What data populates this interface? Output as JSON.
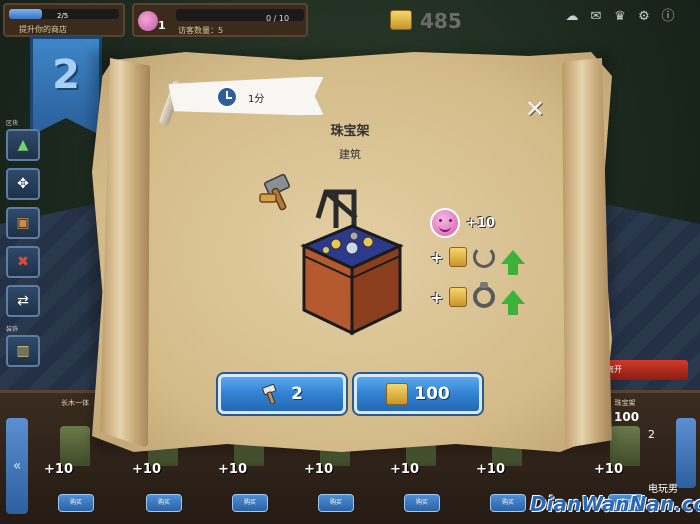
{
  "hud": {
    "xp_value": "2/5",
    "xp_fraction": 0.3,
    "xp_label": "提升你的商店",
    "population_count": "1",
    "population_value": "0 / 10",
    "population_fraction": 0.0,
    "population_label": "访客数量：5",
    "gold": "485",
    "icons": [
      "cloud-icon",
      "mail-icon",
      "trophy-icon",
      "gear-icon",
      "info-icon"
    ]
  },
  "level": {
    "number": "2"
  },
  "left_toolbar": {
    "top_label": "区块",
    "bottom_label": "装饰"
  },
  "dialog": {
    "time": "1分",
    "title": "珠宝架",
    "category": "建筑",
    "close_symbol": "✕",
    "stats": {
      "happiness": "+10"
    },
    "build_cost": "2",
    "gold_cost": "100"
  },
  "bottom_bar": {
    "items": [
      {
        "name": "长木一体",
        "bonus": "+10",
        "buy": "购买"
      },
      {
        "name": "",
        "bonus": "+10",
        "buy": "购买"
      },
      {
        "name": "",
        "bonus": "+10",
        "buy": "购买"
      },
      {
        "name": "",
        "bonus": "+10",
        "buy": "购买"
      },
      {
        "name": "",
        "bonus": "+10",
        "buy": "购买"
      },
      {
        "name": "",
        "bonus": "+10",
        "buy": "购买"
      },
      {
        "name": "珠宝架",
        "bonus": "+10",
        "buy": "购买"
      }
    ],
    "price": "100",
    "price_sub": "2",
    "red_button": "离开"
  },
  "watermark": {
    "text": "DianWanNan.com",
    "sub": "电玩男"
  },
  "colors": {
    "button_blue": "#3281d2",
    "arrow_green": "#3db23a",
    "scroll": "#d3ba88"
  }
}
